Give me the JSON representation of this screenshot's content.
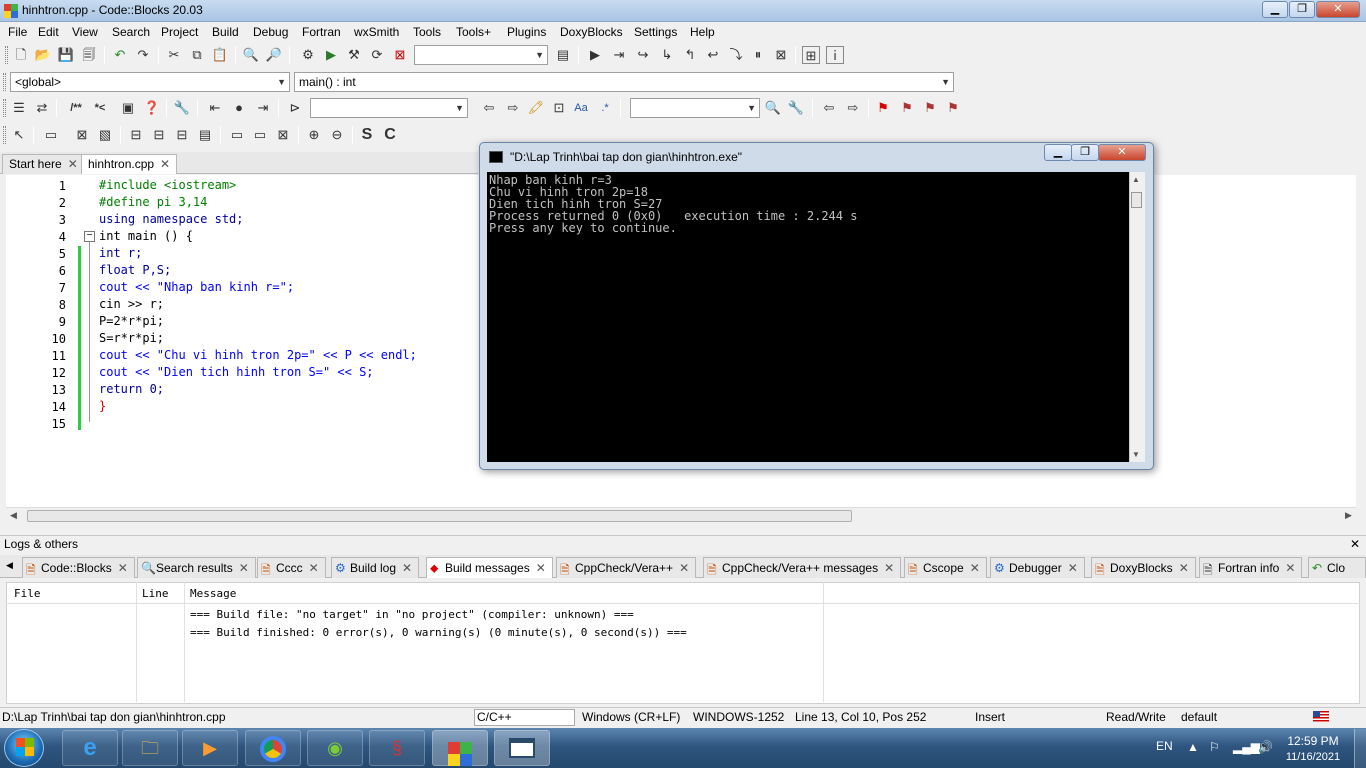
{
  "window": {
    "title": "hinhtron.cpp - Code::Blocks 20.03",
    "btn_min": "▁",
    "btn_max": "❐",
    "btn_close": "✕"
  },
  "menu": [
    "File",
    "Edit",
    "View",
    "Search",
    "Project",
    "Build",
    "Debug",
    "Fortran",
    "wxSmith",
    "Tools",
    "Tools+",
    "Plugins",
    "DoxyBlocks",
    "Settings",
    "Help"
  ],
  "scope": {
    "global": "<global>",
    "function": "main() : int"
  },
  "editor_tabs": [
    {
      "label": "Start here",
      "close": "✕"
    },
    {
      "label": "hinhtron.cpp",
      "close": "✕"
    }
  ],
  "code_lines": [
    {
      "n": "1",
      "t": "#include <iostream>"
    },
    {
      "n": "2",
      "t": "#define pi 3,14"
    },
    {
      "n": "3",
      "t": "using namespace std;"
    },
    {
      "n": "4",
      "t": "int main () {"
    },
    {
      "n": "5",
      "t": "int r;"
    },
    {
      "n": "6",
      "t": "float P,S;"
    },
    {
      "n": "7",
      "t": "cout << \"Nhap ban kinh r=\";"
    },
    {
      "n": "8",
      "t": "cin >> r;"
    },
    {
      "n": "9",
      "t": "P=2*r*pi;"
    },
    {
      "n": "10",
      "t": "S=r*r*pi;"
    },
    {
      "n": "11",
      "t": "cout << \"Chu vi hinh tron 2p=\" << P << endl;"
    },
    {
      "n": "12",
      "t": "cout << \"Dien tich hinh tron S=\" << S;"
    },
    {
      "n": "13",
      "t": "return 0;"
    },
    {
      "n": "14",
      "t": "}"
    },
    {
      "n": "15",
      "t": ""
    }
  ],
  "console": {
    "title": "\"D:\\Lap Trinh\\bai tap don gian\\hinhtron.exe\"",
    "lines": [
      "Nhap ban kinh r=3",
      "Chu vi hinh tron 2p=18",
      "Dien tich hinh tron S=27",
      "Process returned 0 (0x0)   execution time : 2.244 s",
      "Press any key to continue."
    ]
  },
  "logs": {
    "header": "Logs & others",
    "close": "✕",
    "tabs": [
      {
        "label": "Code::Blocks"
      },
      {
        "label": "Search results"
      },
      {
        "label": "Cccc"
      },
      {
        "label": "Build log"
      },
      {
        "label": "Build messages"
      },
      {
        "label": "CppCheck/Vera++"
      },
      {
        "label": "CppCheck/Vera++ messages"
      },
      {
        "label": "Cscope"
      },
      {
        "label": "Debugger"
      },
      {
        "label": "DoxyBlocks"
      },
      {
        "label": "Fortran info"
      },
      {
        "label": "Clo"
      }
    ],
    "columns": [
      "File",
      "Line",
      "Message"
    ],
    "rows": [
      "=== Build file: \"no target\" in \"no project\" (compiler: unknown) ===",
      "=== Build finished: 0 error(s), 0 warning(s) (0 minute(s), 0 second(s)) ==="
    ]
  },
  "status": {
    "path": "D:\\Lap Trinh\\bai tap don gian\\hinhtron.cpp",
    "lang": "C/C++",
    "eol": "Windows (CR+LF)",
    "enc": "WINDOWS-1252",
    "pos": "Line 13, Col 10, Pos 252",
    "mode": "Insert",
    "rw": "Read/Write",
    "profile": "default"
  },
  "taskbar": {
    "lang": "EN",
    "time": "12:59 PM",
    "date": "11/16/2021"
  },
  "colors": {
    "console_bg": "#000000",
    "console_text": "#c0c0c0",
    "keyword": "#0000a0",
    "preproc": "#008000",
    "string": "#0000ff",
    "change_bar": "#2ecc40"
  }
}
